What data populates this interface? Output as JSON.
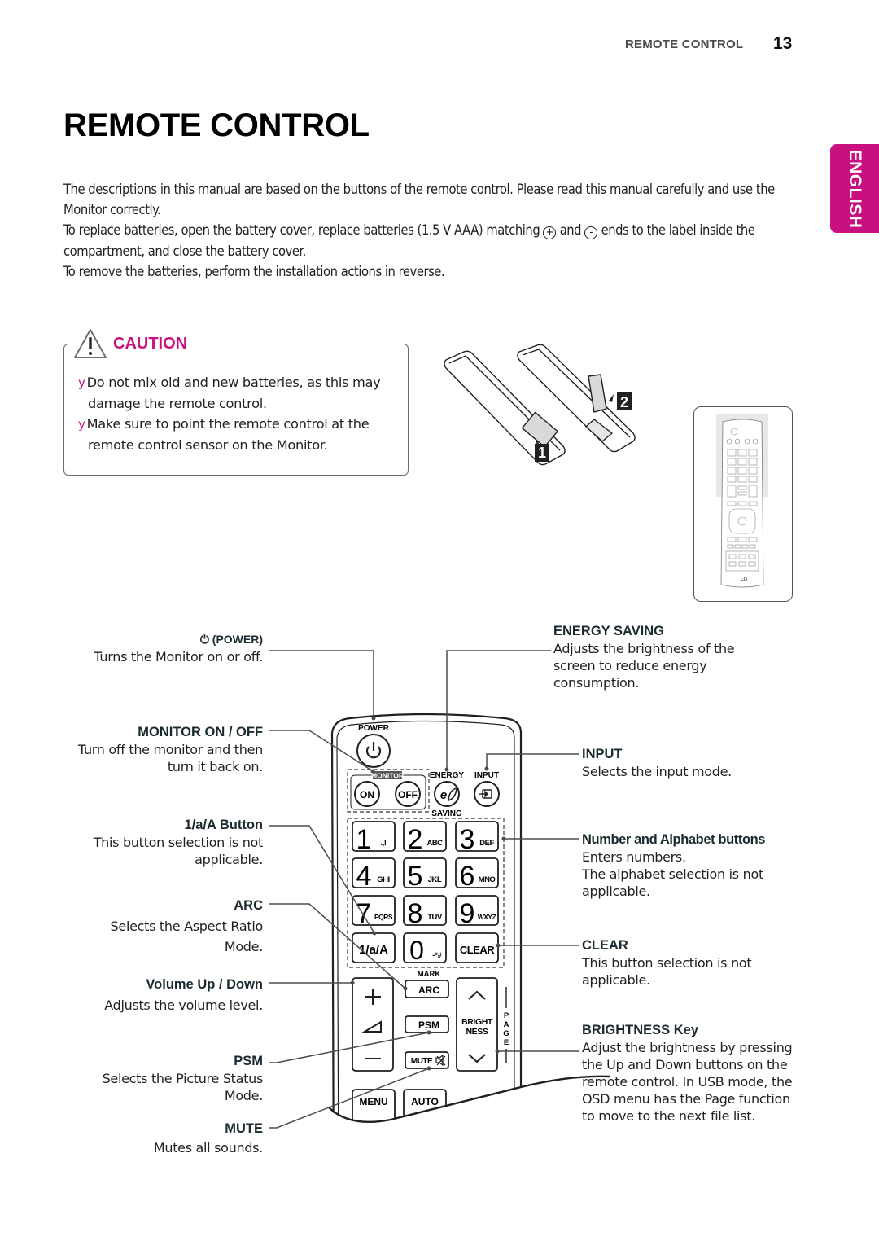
{
  "header": {
    "running_title": "REMOTE CONTROL",
    "page_number": "13"
  },
  "language_tab": {
    "label": "ENGLISH",
    "color": "#c8117e"
  },
  "page_title": "REMOTE CONTROL",
  "intro": {
    "p1": "The descriptions in this manual are based on the buttons of the remote control. Please read this manual carefully and use the Monitor correctly.",
    "p2_before": "To replace batteries, open the battery cover, replace batteries (1.5 V AAA) matching ",
    "plus_glyph": "+",
    "p2_mid": " and ",
    "minus_glyph": "-",
    "p2_after": " ends to the label inside the compartment, and close the battery cover.",
    "p3": "To remove the batteries, perform the installation actions in reverse."
  },
  "caution": {
    "label": "CAUTION",
    "bullet_glyph": "y",
    "items": [
      "Do not mix old and new batteries, as this may damage the remote control.",
      "Make sure to point the remote control at the remote control sensor on the Monitor."
    ]
  },
  "battery_steps": {
    "step1": "1",
    "step2": "2"
  },
  "mini_remote": {
    "brand": "LG"
  },
  "callouts_left": [
    {
      "title": "(POWER)",
      "desc": "Turns the Monitor on or off."
    },
    {
      "title": "MONITOR ON / OFF",
      "desc": "Turn off the monitor and then turn it back on."
    },
    {
      "title": "1/a/A Button",
      "desc": "This button selection is not applicable."
    },
    {
      "title": "ARC",
      "desc": "Selects the Aspect Ratio Mode."
    },
    {
      "title": "Volume Up / Down",
      "desc": "Adjusts the volume level."
    },
    {
      "title": "PSM",
      "desc": "Selects the Picture Status Mode."
    },
    {
      "title": "MUTE",
      "desc": "Mutes all sounds."
    }
  ],
  "callouts_right": [
    {
      "title": "ENERGY SAVING",
      "desc": "Adjusts the brightness of the screen to reduce energy consumption."
    },
    {
      "title": "INPUT",
      "desc": "Selects the input mode."
    },
    {
      "title": "Number and Alphabet buttons",
      "desc1": "Enters numbers.",
      "desc2": "The alphabet selection is not applicable."
    },
    {
      "title": "CLEAR",
      "desc": "This button selection is not applicable."
    },
    {
      "title": "BRIGHTNESS Key",
      "desc": "Adjust the brightness by pressing the Up and Down buttons on the remote control. In USB mode, the OSD menu has the Page function to move to the next file list."
    }
  ],
  "remote": {
    "power_label": "POWER",
    "monitor_label": "MONITOR",
    "on_label": "ON",
    "off_label": "OFF",
    "energy_label": "ENERGY",
    "saving_label": "SAVING",
    "input_label": "INPUT",
    "keys": [
      {
        "digit": "1",
        "letters": ".,!"
      },
      {
        "digit": "2",
        "letters": "ABC"
      },
      {
        "digit": "3",
        "letters": "DEF"
      },
      {
        "digit": "4",
        "letters": "GHI"
      },
      {
        "digit": "5",
        "letters": "JKL"
      },
      {
        "digit": "6",
        "letters": "MNO"
      },
      {
        "digit": "7",
        "letters": "PQRS"
      },
      {
        "digit": "8",
        "letters": "TUV"
      },
      {
        "digit": "9",
        "letters": "WXYZ"
      }
    ],
    "mode_key": "1/a/A",
    "zero_digit": "0",
    "zero_letters": "-*#",
    "clear_label": "CLEAR",
    "mark_label": "MARK",
    "arc_label": "ARC",
    "psm_label": "PSM",
    "mute_label": "MUTE",
    "vol_plus": "+",
    "vol_minus": "−",
    "bright_label_1": "BRIGHT",
    "bright_label_2": "NESS",
    "page_label": "PAGE",
    "menu_label": "MENU",
    "auto_label": "AUTO"
  }
}
